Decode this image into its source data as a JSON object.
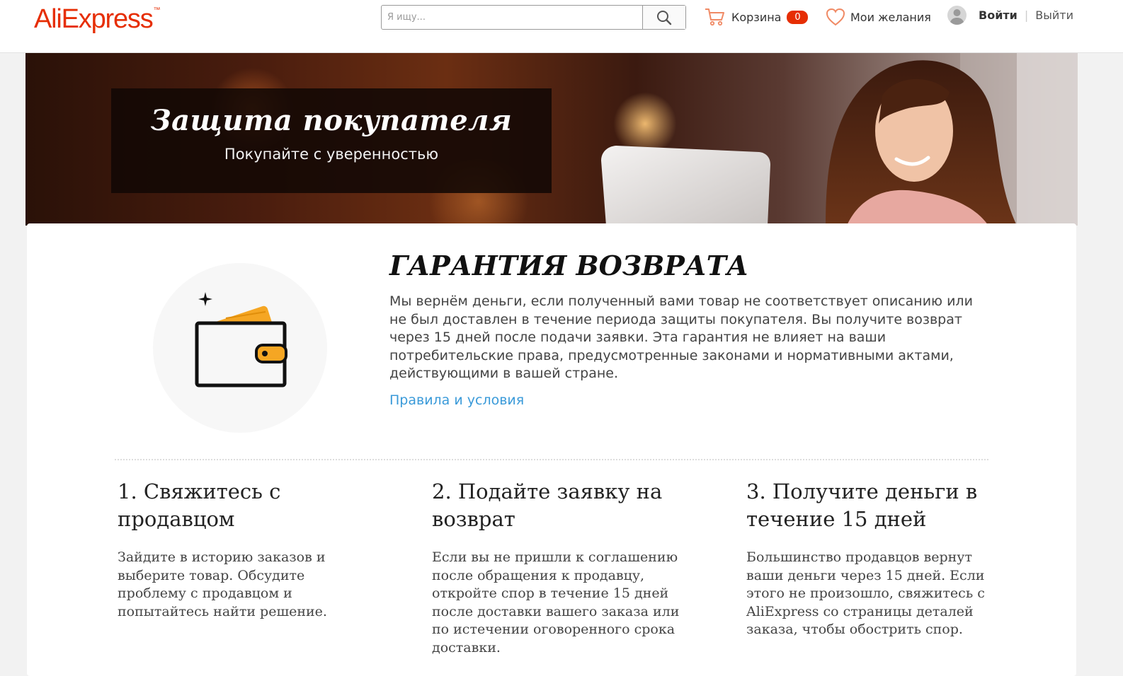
{
  "header": {
    "logo": "AliExpress",
    "logo_mark": "™",
    "search_placeholder": "Я ищу...",
    "search_value": "",
    "search_icon": "search-icon",
    "cart_label": "Корзина",
    "cart_count": "0",
    "wishlist_label": "Мои желания",
    "login_label": "Войти",
    "separator": "|",
    "logout_label": "Выйти"
  },
  "hero": {
    "title": "Защита покупателя",
    "subtitle": "Покупайте с уверенностью"
  },
  "guarantee": {
    "title": "ГАРАНТИЯ ВОЗВРАТА",
    "text": "Мы вернём деньги, если полученный вами товар не соответствует описанию или не был доставлен в течение периода защиты покупателя. Вы получите возврат через 15 дней после подачи заявки. Эта гарантия не влияет на ваши потребительские права, предусмотренные законами и нормативными актами, действующими в вашей стране.",
    "link": "Правила и условия",
    "icon": "wallet-icon"
  },
  "steps": [
    {
      "title": "1. Свяжитесь с продавцом",
      "text": "Зайдите в историю заказов и выберите товар. Обсудите проблему с продавцом и попытайтесь найти решение."
    },
    {
      "title": "2. Подайте заявку на возврат",
      "text": "Если вы не пришли к соглашению после обращения к продавцу, откройте спор в течение 15 дней после доставки вашего заказа или по истечении оговоренного срока доставки."
    },
    {
      "title": "3. Получите деньги в течение 15 дней",
      "text": "Большинство продавцов вернут ваши деньги через 15 дней. Если этого не произошло, свяжитесь с AliExpress со страницы деталей заказа, чтобы обострить спор."
    }
  ],
  "colors": {
    "brand": "#e62e04",
    "link": "#3a9ad9",
    "wallet_card": "#f5a623"
  }
}
